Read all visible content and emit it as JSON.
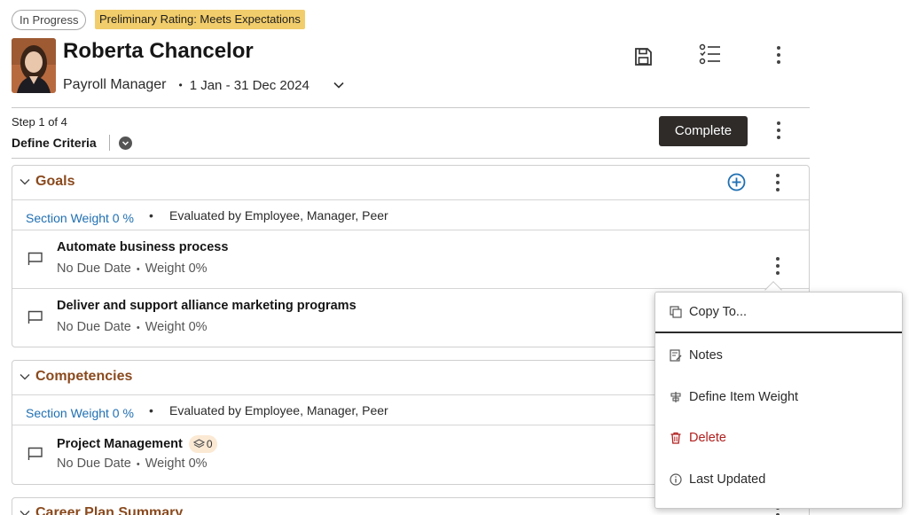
{
  "header": {
    "status_badge": "In Progress",
    "rating_badge": "Preliminary Rating: Meets Expectations",
    "employee_name": "Roberta Chancelor",
    "job_title": "Payroll Manager",
    "separator": "•",
    "period": "1 Jan - 31 Dec 2024",
    "icons": [
      "save-icon",
      "checklist-icon",
      "more-vertical-icon"
    ]
  },
  "step": {
    "counter": "Step 1 of 4",
    "name": "Define Criteria",
    "complete_label": "Complete"
  },
  "sections": [
    {
      "title": "Goals",
      "weight_link": "Section Weight 0 %",
      "evaluated_by": "Evaluated by Employee, Manager, Peer",
      "items": [
        {
          "title": "Automate business process",
          "due": "No Due Date",
          "weight": "Weight 0%"
        },
        {
          "title": "Deliver and support alliance marketing programs",
          "due": "No Due Date",
          "weight": "Weight 0%"
        }
      ]
    },
    {
      "title": "Competencies",
      "weight_link": "Section Weight 0 %",
      "evaluated_by": "Evaluated by Employee, Manager, Peer",
      "items": [
        {
          "title": "Project Management",
          "chip_count": "0",
          "due": "No Due Date",
          "weight": "Weight 0%"
        }
      ]
    },
    {
      "title": "Career Plan Summary"
    }
  ],
  "context_menu": {
    "items": [
      {
        "label": "Copy To...",
        "icon": "copy-icon"
      },
      {
        "label": "Notes",
        "icon": "notes-icon"
      },
      {
        "label": "Define Item Weight",
        "icon": "weight-icon"
      },
      {
        "label": "Delete",
        "icon": "trash-icon"
      },
      {
        "label": "Last Updated",
        "icon": "info-icon"
      }
    ]
  },
  "colors": {
    "rating_badge": "#f2cd6b",
    "section_title": "#8a4a1e",
    "link": "#1f6fb2",
    "complete_button": "#2e2b29",
    "add_icon": "#1f6fb2",
    "delete": "#b0201f"
  }
}
